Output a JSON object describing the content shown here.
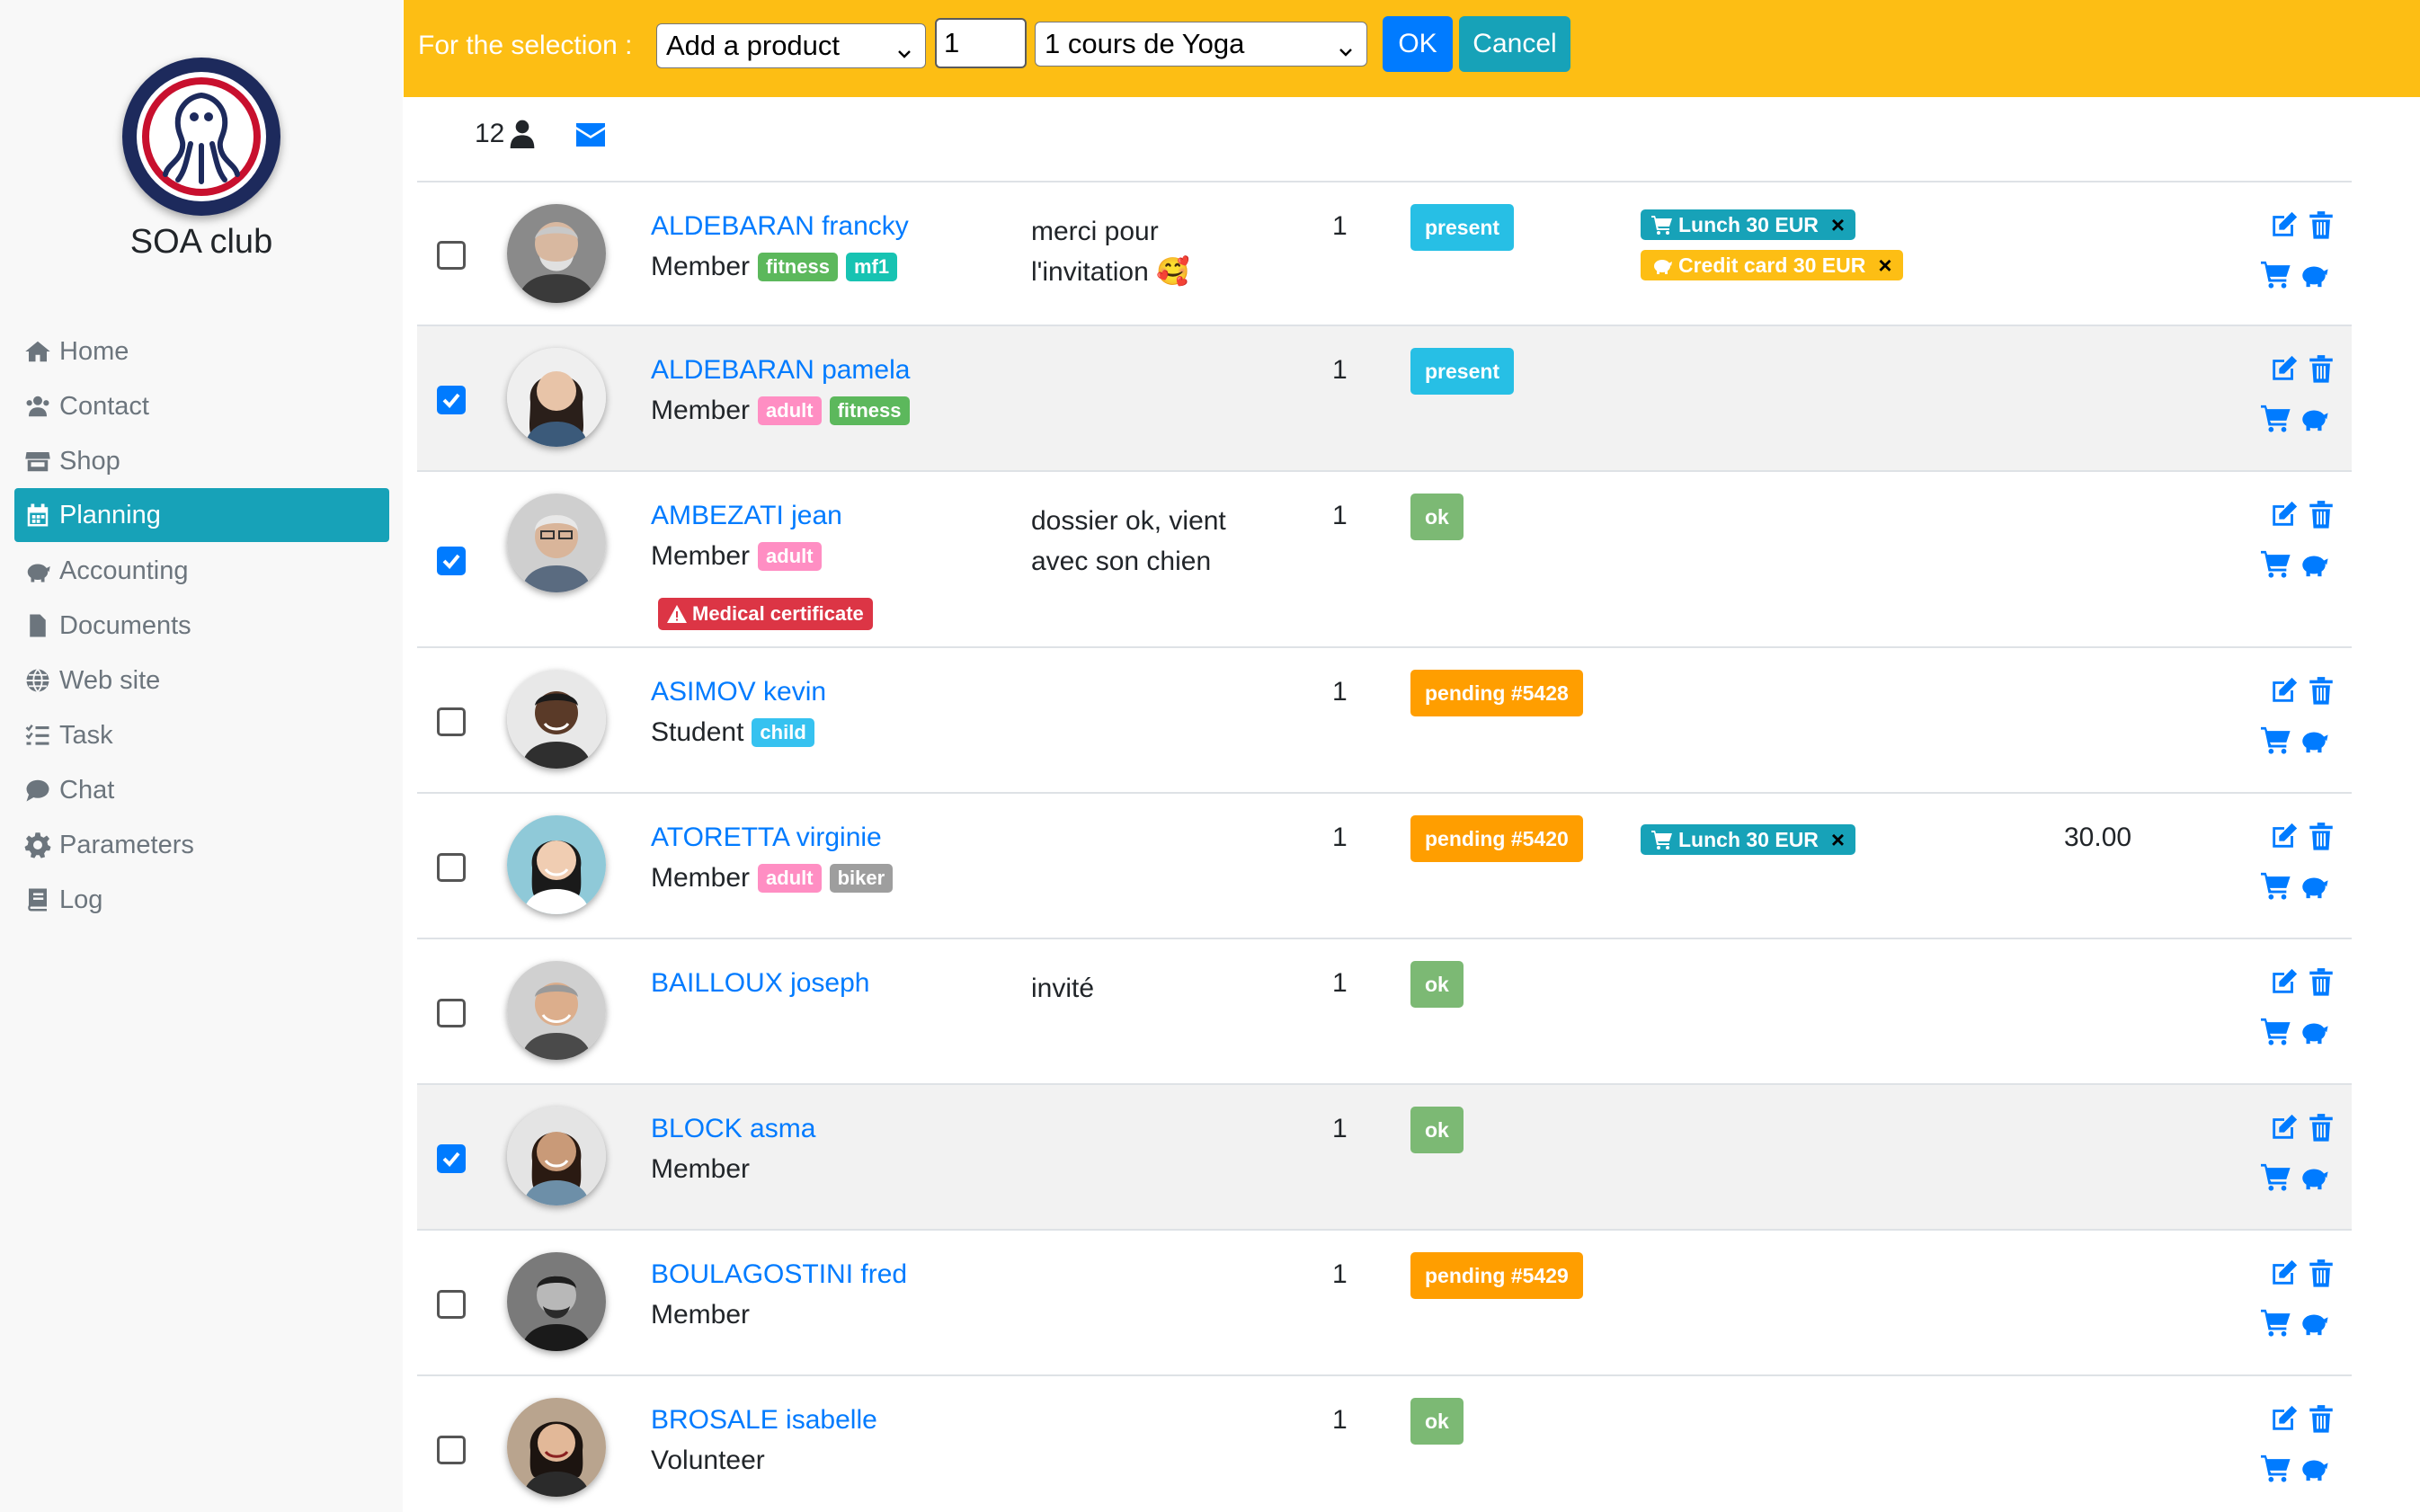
{
  "sidebar": {
    "club_name": "SOA club",
    "logo_icon": "club-logo-icon",
    "items": [
      {
        "label": "Home",
        "icon": "home-icon"
      },
      {
        "label": "Contact",
        "icon": "users-icon"
      },
      {
        "label": "Shop",
        "icon": "store-icon"
      },
      {
        "label": "Planning",
        "icon": "calendar-icon",
        "active": true
      },
      {
        "label": "Accounting",
        "icon": "piggy-bank-icon"
      },
      {
        "label": "Documents",
        "icon": "file-icon"
      },
      {
        "label": "Web site",
        "icon": "globe-icon"
      },
      {
        "label": "Task",
        "icon": "task-list-icon"
      },
      {
        "label": "Chat",
        "icon": "chat-bubble-icon"
      },
      {
        "label": "Parameters",
        "icon": "gear-icon"
      },
      {
        "label": "Log",
        "icon": "book-icon"
      }
    ]
  },
  "toolbar": {
    "label": "For the selection :",
    "action_select": "Add a product",
    "quantity": "1",
    "product_select": "1 cours de Yoga",
    "ok_label": "OK",
    "cancel_label": "Cancel"
  },
  "summary": {
    "count": "12"
  },
  "colors": {
    "accent": "#17a2b8",
    "link": "#007bff",
    "toolbar": "#fdbe14"
  },
  "participants": [
    {
      "name": "ALDEBARAN francky",
      "role": "Member",
      "tags": [
        "fitness",
        "mf1"
      ],
      "comment": "merci pour l'invitation 🥰",
      "qty": "1",
      "status": "present",
      "status_kind": "present",
      "products": [
        {
          "label": "Lunch 30 EUR",
          "kind": "teal"
        },
        {
          "label": "Credit card 30 EUR",
          "kind": "yellow"
        }
      ],
      "amount": "",
      "checked": false
    },
    {
      "name": "ALDEBARAN pamela",
      "role": "Member",
      "tags": [
        "adult",
        "fitness"
      ],
      "comment": "",
      "qty": "1",
      "status": "present",
      "status_kind": "present",
      "products": [],
      "amount": "",
      "checked": true
    },
    {
      "name": "AMBEZATI jean",
      "role": "Member",
      "tags": [
        "adult"
      ],
      "medical": "Medical certificate",
      "comment": "dossier ok, vient avec son chien",
      "qty": "1",
      "status": "ok",
      "status_kind": "ok",
      "products": [],
      "amount": "",
      "checked": true
    },
    {
      "name": "ASIMOV kevin",
      "role": "Student",
      "tags": [
        "child"
      ],
      "comment": "",
      "qty": "1",
      "status": "pending #5428",
      "status_kind": "pending",
      "products": [],
      "amount": "",
      "checked": false
    },
    {
      "name": "ATORETTA virginie",
      "role": "Member",
      "tags": [
        "adult",
        "biker"
      ],
      "comment": "",
      "qty": "1",
      "status": "pending #5420",
      "status_kind": "pending",
      "products": [
        {
          "label": "Lunch 30 EUR",
          "kind": "teal"
        }
      ],
      "amount": "30.00",
      "checked": false
    },
    {
      "name": "BAILLOUX joseph",
      "role": "",
      "tags": [],
      "comment": "invité",
      "qty": "1",
      "status": "ok",
      "status_kind": "ok",
      "products": [],
      "amount": "",
      "checked": false
    },
    {
      "name": "BLOCK asma",
      "role": "Member",
      "tags": [],
      "comment": "",
      "qty": "1",
      "status": "ok",
      "status_kind": "ok",
      "products": [],
      "amount": "",
      "checked": true
    },
    {
      "name": "BOULAGOSTINI fred",
      "role": "Member",
      "tags": [],
      "comment": "",
      "qty": "1",
      "status": "pending #5429",
      "status_kind": "pending",
      "products": [],
      "amount": "",
      "checked": false
    },
    {
      "name": "BROSALE isabelle",
      "role": "Volunteer",
      "tags": [],
      "comment": "",
      "qty": "1",
      "status": "ok",
      "status_kind": "ok",
      "products": [],
      "amount": "",
      "checked": false
    }
  ]
}
